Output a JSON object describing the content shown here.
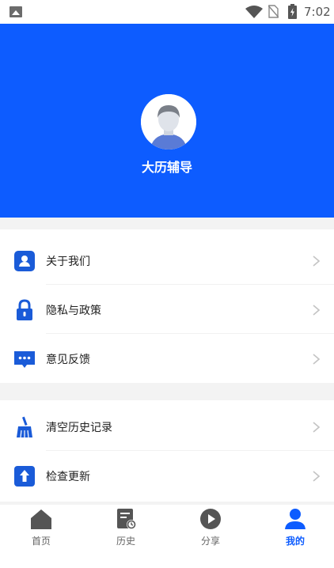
{
  "status_bar": {
    "time": "7:02"
  },
  "profile": {
    "app_name": "大历辅导"
  },
  "menu_group_1": [
    {
      "label": "关于我们",
      "icon": "user-card-icon"
    },
    {
      "label": "隐私与政策",
      "icon": "lock-icon"
    },
    {
      "label": "意见反馈",
      "icon": "chat-bubble-icon"
    }
  ],
  "menu_group_2": [
    {
      "label": "清空历史记录",
      "icon": "broom-icon"
    },
    {
      "label": "检查更新",
      "icon": "upload-arrow-icon"
    }
  ],
  "tabs": [
    {
      "label": "首页",
      "icon": "home-icon",
      "active": false
    },
    {
      "label": "历史",
      "icon": "history-icon",
      "active": false
    },
    {
      "label": "分享",
      "icon": "play-share-icon",
      "active": false
    },
    {
      "label": "我的",
      "icon": "person-icon",
      "active": true
    }
  ],
  "colors": {
    "accent": "#0d5cff",
    "inactive_icon": "#555555",
    "menu_icon": "#1a5bd8"
  }
}
